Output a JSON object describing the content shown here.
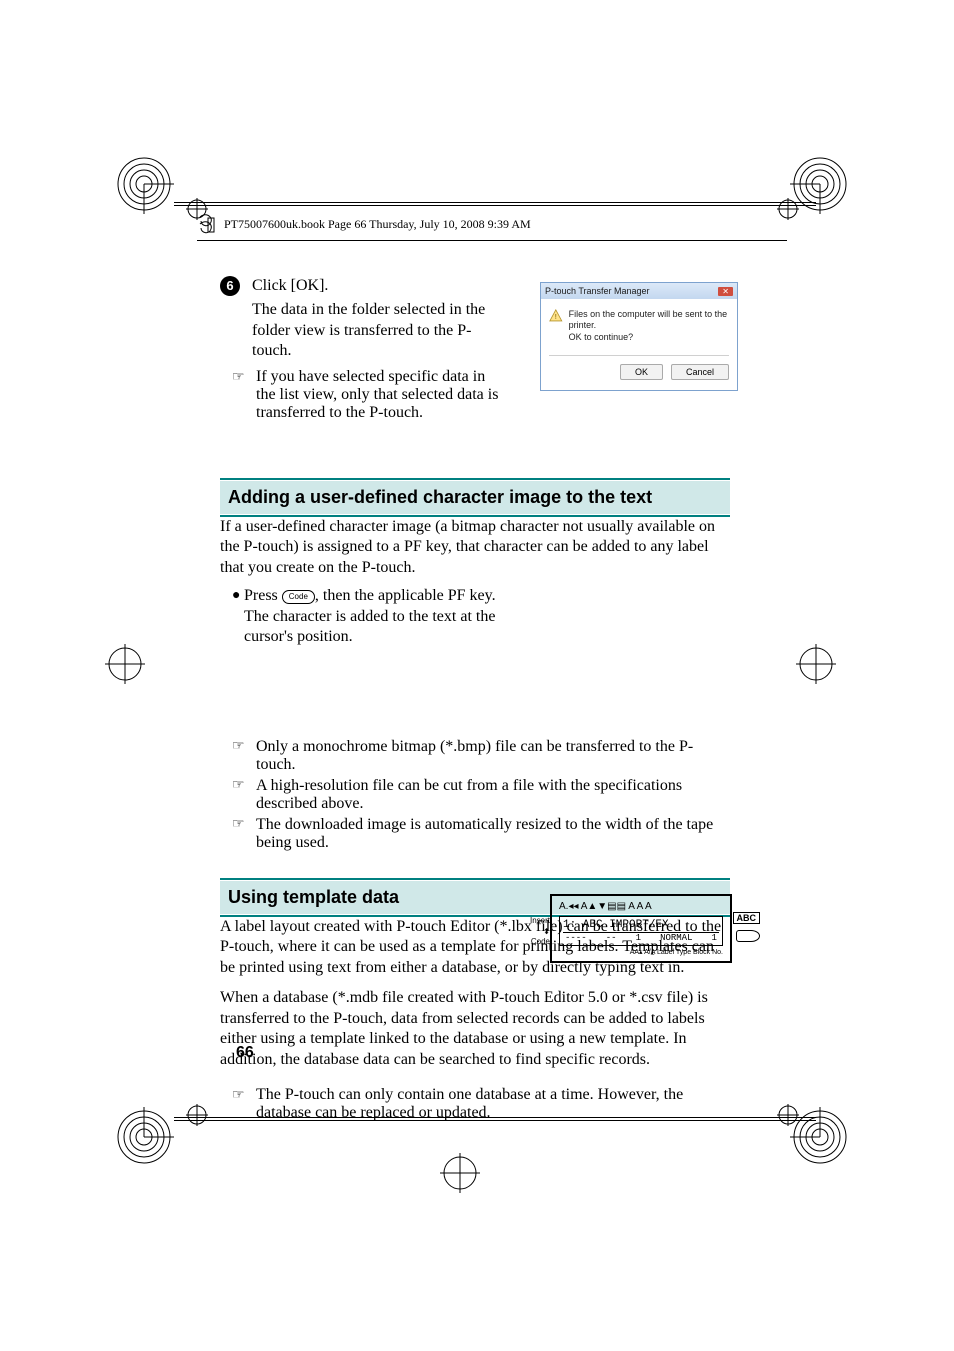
{
  "header": {
    "running_head": "PT75007600uk.book  Page 66  Thursday, July 10, 2008  9:39 AM"
  },
  "step6": {
    "number": "6",
    "line1": "Click [OK].",
    "line2": "The data in the folder selected in the folder view is transferred to the P-touch.",
    "note": "If you have selected specific data in the list view, only that selected data is transferred to the P-touch."
  },
  "dialog": {
    "title": "P-touch Transfer Manager",
    "message_line1": "Files on the computer will be sent to the printer.",
    "message_line2": "OK to continue?",
    "ok": "OK",
    "cancel": "Cancel"
  },
  "section1": {
    "title": "Adding a user-defined character image to the text",
    "intro": "If a user-defined character image (a bitmap character not usually available on the P-touch) is assigned to a PF key, that character can be added to any label that you create on the P-touch.",
    "bullet_prefix": "Press ",
    "bullet_suffix": ", then the applicable PF key. The character is added to the text at the cursor's position.",
    "code_key": "Code",
    "note1": "Only a monochrome bitmap (*.bmp) file can be transferred to the P-touch.",
    "note2": "A high-resolution file can be cut from a file with the specifications described above.",
    "note3": "The downloaded image is automatically resized to the width of the tape being used."
  },
  "lcd": {
    "indicator_line": "A.◂◂     A▲▼▤▤   A  A  A",
    "left_labels": "Insert\n⬍\nCode",
    "display_text": "1:   ABC IMPORT/EX",
    "status_left": "----",
    "status_mid1": "--",
    "status_mid2": "1",
    "status_mode": "NORMAL",
    "status_right": "1",
    "right_badge": "ABC",
    "bottomrow": "AA▴  A/A   Label Type  Block No."
  },
  "section2": {
    "title": "Using template data",
    "para1": "A label layout created with P-touch Editor (*.lbx file) can be transferred to the P-touch, where it can be used as a template for printing labels. Templates can be printed using text from either a database, or by directly typing text in.",
    "para2": "When a database (*.mdb file created with P-touch Editor 5.0 or *.csv file) is transferred to the P-touch, data from selected records can be added to labels either using a template linked to the database or using a new template. In addition, the database data can be searched to find specific records.",
    "note": "The P-touch can only contain one database at a time. However, the database can be replaced or updated."
  },
  "footer": {
    "page_number": "66"
  }
}
